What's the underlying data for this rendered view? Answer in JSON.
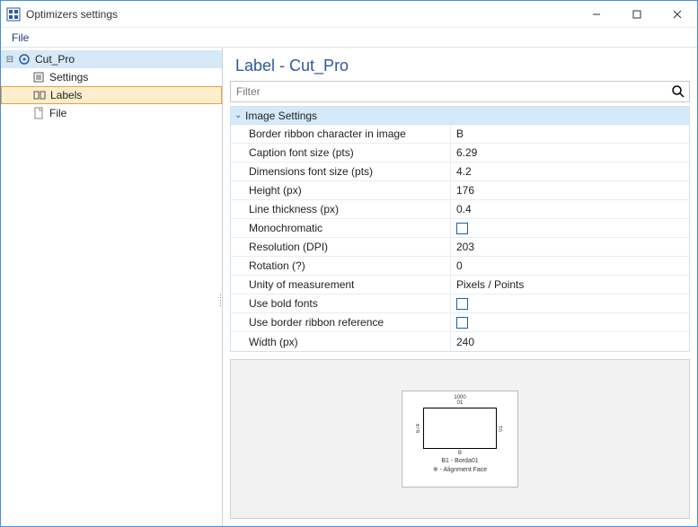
{
  "window": {
    "title": "Optimizers settings"
  },
  "menubar": {
    "file": "File"
  },
  "tree": {
    "root": "Cut_Pro",
    "items": [
      "Settings",
      "Labels",
      "File"
    ],
    "selected_index": 1
  },
  "main": {
    "header": "Label - Cut_Pro",
    "filter_placeholder": "Filter",
    "section_title": "Image Settings",
    "props": [
      {
        "name": "Border ribbon character in image",
        "value": "B",
        "type": "text"
      },
      {
        "name": "Caption font size (pts)",
        "value": "6.29",
        "type": "text"
      },
      {
        "name": "Dimensions font size (pts)",
        "value": "4.2",
        "type": "text"
      },
      {
        "name": "Height (px)",
        "value": "176",
        "type": "text"
      },
      {
        "name": "Line thickness (px)",
        "value": "0.4",
        "type": "text"
      },
      {
        "name": "Monochromatic",
        "value": false,
        "type": "bool"
      },
      {
        "name": "Resolution (DPI)",
        "value": "203",
        "type": "text"
      },
      {
        "name": "Rotation (?)",
        "value": "0",
        "type": "text"
      },
      {
        "name": "Unity of measurement",
        "value": "Pixels / Points",
        "type": "text"
      },
      {
        "name": "Use bold fonts",
        "value": false,
        "type": "bool"
      },
      {
        "name": "Use border ribbon reference",
        "value": false,
        "type": "bool"
      },
      {
        "name": "Width (px)",
        "value": "240",
        "type": "text"
      }
    ],
    "preview": {
      "top_dim": "1000",
      "sub_dim": "01",
      "left_dim": "674",
      "right_dim": "01",
      "bottom_dim": "B",
      "caption_lines": [
        "B1 - Borda01",
        "※ - Alignment Face"
      ]
    }
  }
}
